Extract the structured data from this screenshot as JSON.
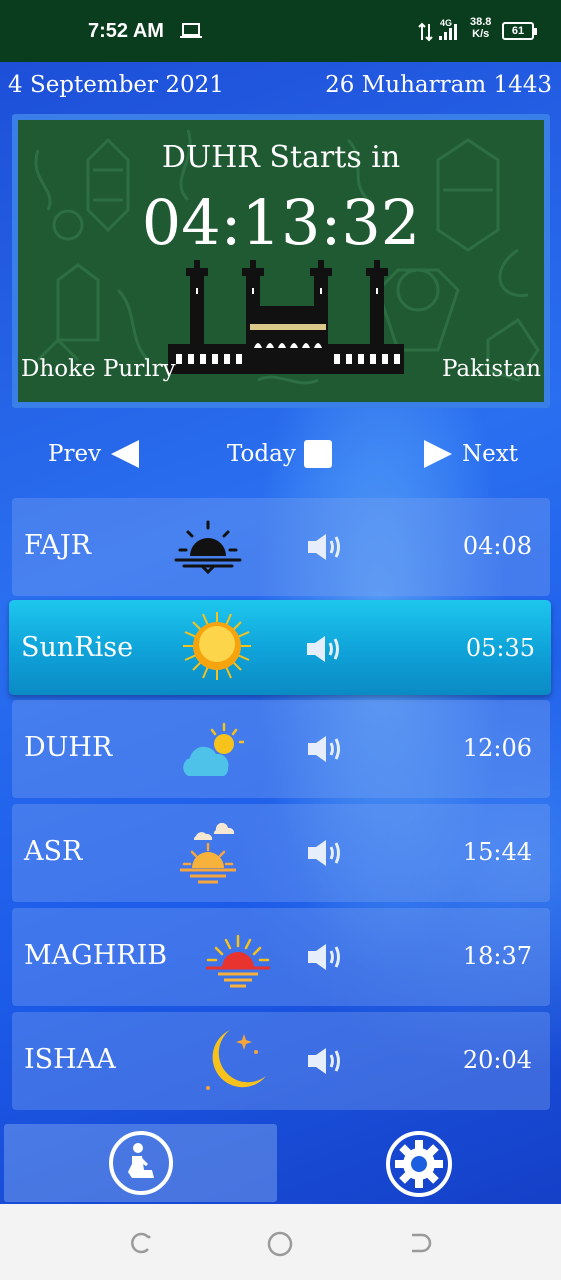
{
  "status_bar": {
    "time": "7:52 AM",
    "network": "4G",
    "speed_value": "38.8",
    "speed_unit": "K/s",
    "battery": "61",
    "colors": {
      "background": "#0a3d1e"
    }
  },
  "dates": {
    "gregorian": "4 September 2021",
    "hijri": "26 Muharram 1443"
  },
  "hero": {
    "title": "DUHR  Starts in",
    "countdown": "04:13:32",
    "city": "Dhoke Purlry",
    "country": "Pakistan",
    "colors": {
      "panel": "#1f5a32",
      "border": "#3a7fe8"
    }
  },
  "nav": {
    "prev_label": "Prev",
    "today_label": "Today",
    "next_label": "Next"
  },
  "prayers": [
    {
      "name": "FAJR",
      "time": "04:08",
      "icon": "dawn-sunrise-icon",
      "active": false
    },
    {
      "name": "SunRise",
      "time": "05:35",
      "icon": "sun-icon",
      "active": true
    },
    {
      "name": "DUHR",
      "time": "12:06",
      "icon": "sun-cloud-icon",
      "active": false
    },
    {
      "name": "ASR",
      "time": "15:44",
      "icon": "sunset-clouds-icon",
      "active": false
    },
    {
      "name": "MAGHRIB",
      "time": "18:37",
      "icon": "sunset-red-icon",
      "active": false
    },
    {
      "name": "ISHAA",
      "time": "20:04",
      "icon": "crescent-moon-icon",
      "active": false
    }
  ],
  "bottom_bar": {
    "left_icon": "praying-person-icon",
    "right_icon": "gear-icon"
  },
  "theme": {
    "active_row": "#1ec6ee",
    "app_background": "#1b5fe0"
  }
}
